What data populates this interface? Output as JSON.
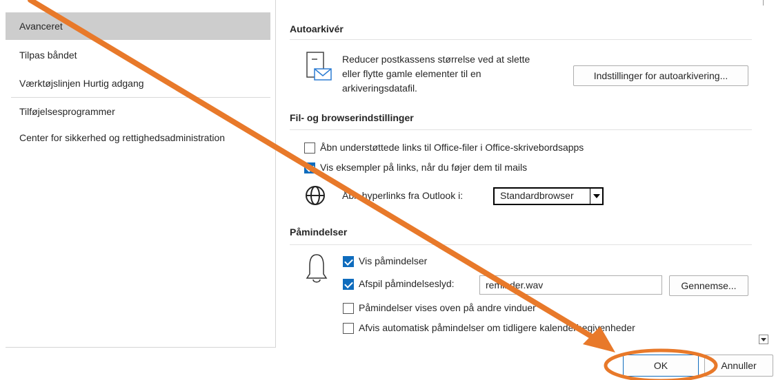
{
  "nav": {
    "items": [
      {
        "label": "Avanceret"
      },
      {
        "label": "Tilpas båndet"
      },
      {
        "label": "Værktøjslinjen Hurtig adgang"
      },
      {
        "label": "Tilføjelsesprogrammer"
      },
      {
        "label": "Center for sikkerhed og rettighedsadministration"
      }
    ]
  },
  "autoarchive": {
    "title": "Autoarkivér",
    "description_line1": "Reducer postkassens størrelse ved at slette",
    "description_line2": "eller flytte gamle elementer til en",
    "description_line3": "arkiveringsdatafil.",
    "settings_button": "Indstillinger for autoarkivering..."
  },
  "file_browser": {
    "title": "Fil- og browserindstillinger",
    "open_links_office": {
      "label": "Åbn understøttede links til Office-filer i Office-skrivebordsapps",
      "checked": false
    },
    "show_link_previews": {
      "label": "Vis eksempler på links, når du føjer dem til mails",
      "checked": true
    },
    "open_hyperlinks_label": "Åbn hyperlinks fra Outlook i:",
    "browser_select_value": "Standardbrowser"
  },
  "reminders": {
    "title": "Påmindelser",
    "show_reminders": {
      "label": "Vis påmindelser",
      "checked": true
    },
    "play_sound": {
      "label": "Afspil påmindelseslyd:",
      "checked": true
    },
    "sound_file": "reminder.wav",
    "browse_button": "Gennemse...",
    "on_top": {
      "label": "Påmindelser vises oven på andre vinduer",
      "checked": false
    },
    "auto_dismiss": {
      "label": "Afvis automatisk påmindelser om tidligere kalenderbegivenheder",
      "checked": false
    }
  },
  "footer": {
    "ok_label": "OK",
    "cancel_label": "Annuller"
  },
  "colors": {
    "accent": "#0f6cbd",
    "annotation": "#e8792a",
    "selected_nav": "#cdcdcd"
  },
  "icons": {
    "archive": "archive-mail-icon",
    "globe": "globe-icon",
    "bell": "bell-icon"
  }
}
